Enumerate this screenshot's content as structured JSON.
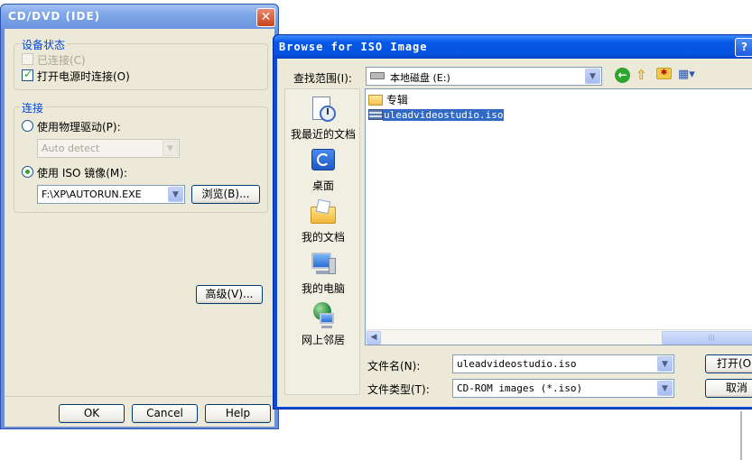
{
  "left_dialog": {
    "title": "CD/DVD (IDE)",
    "close_glyph": "✕",
    "device_status": {
      "title": "设备状态",
      "connected_label": "已连接(C)",
      "connect_at_power_on_label": "打开电源时连接(O)"
    },
    "connection": {
      "title": "连接",
      "physical_drive_label": "使用物理驱动(P):",
      "physical_drive_value": "Auto detect",
      "iso_label": "使用 ISO 镜像(M):",
      "iso_value": "F:\\XP\\AUTORUN.EXE",
      "browse_label": "浏览(B)..."
    },
    "advanced_label": "高级(V)...",
    "ok_label": "OK",
    "cancel_label": "Cancel",
    "help_label": "Help"
  },
  "right_dialog": {
    "title": "Browse for ISO Image",
    "help_glyph": "?",
    "look_in_label": "查找范围(I):",
    "look_in_value": "本地磁盘 (E:)",
    "places": [
      {
        "label": "我最近的文档",
        "icon": "recent-docs-icon"
      },
      {
        "label": "桌面",
        "icon": "desktop-icon"
      },
      {
        "label": "我的文档",
        "icon": "my-documents-icon"
      },
      {
        "label": "我的电脑",
        "icon": "my-computer-icon"
      },
      {
        "label": "网上邻居",
        "icon": "network-places-icon"
      }
    ],
    "files": [
      {
        "name": "专辑",
        "type": "folder"
      },
      {
        "name": "uleadvideostudio.iso",
        "type": "iso",
        "selected": true
      }
    ],
    "filename_label": "文件名(N):",
    "filename_value": "uleadvideostudio.iso",
    "filetype_label": "文件类型(T):",
    "filetype_value": "CD-ROM images (*.iso)",
    "open_label": "打开(O)",
    "cancel_label": "取消"
  },
  "colors": {
    "title_blue": "#0653de",
    "face": "#ece9d8",
    "selection": "#316ac5"
  }
}
